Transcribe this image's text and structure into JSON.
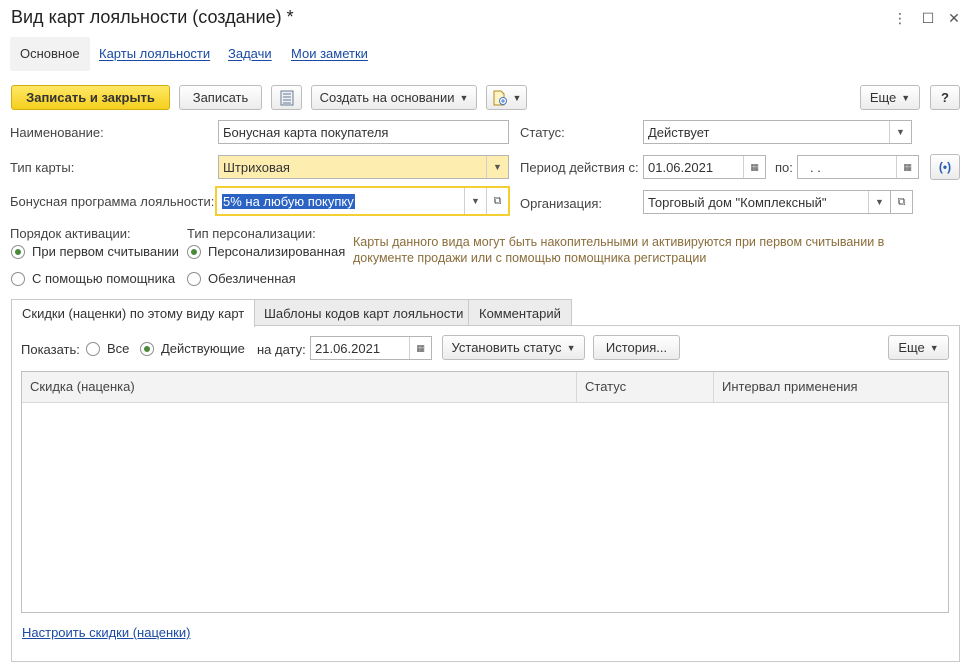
{
  "window": {
    "title": "Вид карт лояльности (создание) *",
    "menu_icon": "⋮",
    "maximize_icon": "☐",
    "close_icon": "✕"
  },
  "nav": {
    "main": "Основное",
    "cards": "Карты лояльности",
    "tasks": "Задачи",
    "notes": "Мои заметки"
  },
  "toolbar": {
    "save_close": "Записать и закрыть",
    "save": "Записать",
    "create_based": "Создать на основании",
    "more": "Еще",
    "help": "?"
  },
  "form": {
    "name_label": "Наименование:",
    "name_value": "Бонусная карта покупателя",
    "card_type_label": "Тип карты:",
    "card_type_value": "Штриховая",
    "program_label": "Бонусная программа лояльности:",
    "program_value": "5% на любую покупку",
    "status_label": "Статус:",
    "status_value": "Действует",
    "period_label": "Период действия с:",
    "period_from": "01.06.2021",
    "period_to_label": "по:",
    "period_to": " .  .",
    "org_label": "Организация:",
    "org_value": "Торговый дом \"Комплексный\""
  },
  "activation": {
    "label": "Порядок активации:",
    "opt1": "При первом считывании",
    "opt2": "С помощью помощника",
    "selected": 1
  },
  "personalization": {
    "label": "Тип персонализации:",
    "opt1": "Персонализированная",
    "opt2": "Обезличенная",
    "selected": 1
  },
  "hint": "Карты данного вида могут быть накопительными и активируются при первом считывании в документе продажи или с помощью помощника регистрации",
  "tabs": {
    "discounts": "Скидки (наценки) по этому виду карт",
    "templates": "Шаблоны кодов карт лояльности",
    "comment": "Комментарий"
  },
  "filter": {
    "show_label": "Показать:",
    "all": "Все",
    "active": "Действующие",
    "date_label": "на дату:",
    "date_value": "21.06.2021",
    "set_status": "Установить статус",
    "history": "История...",
    "more": "Еще"
  },
  "grid": {
    "columns": [
      "Скидка (наценка)",
      "Статус",
      "Интервал применения"
    ],
    "rows": []
  },
  "footer_link": "Настроить скидки (наценки)",
  "colors": {
    "accent": "#f5cf1d",
    "link": "#1a4aa3",
    "hint": "#8a6d3b",
    "required": "#fdeeb0"
  }
}
